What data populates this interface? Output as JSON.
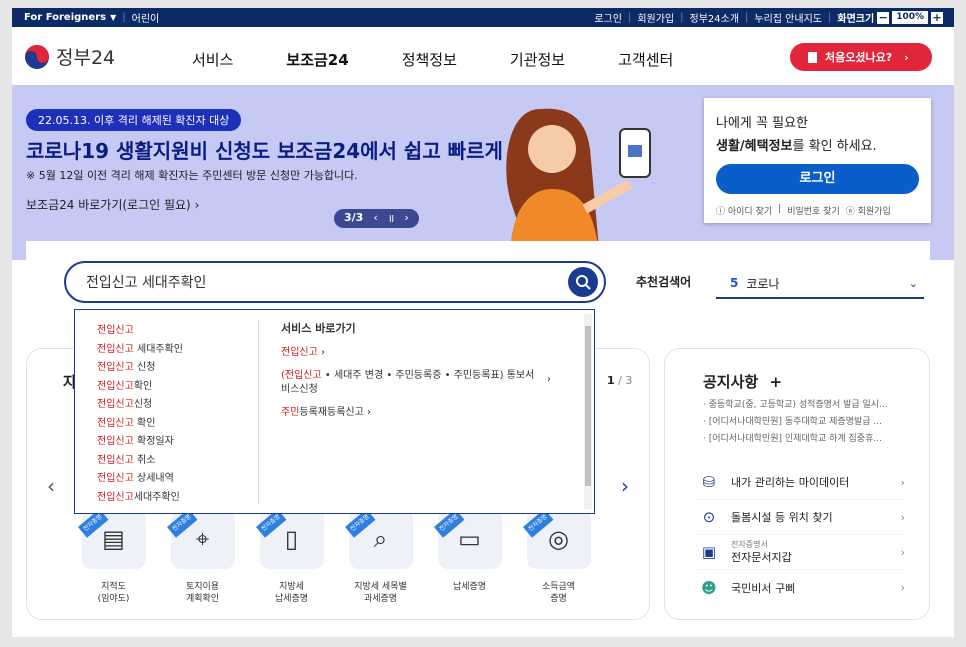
{
  "topbar": {
    "foreigners": "For Foreigners",
    "children": "어린이",
    "login": "로그인",
    "signup": "회원가입",
    "intro": "정부24소개",
    "sitemap": "누리집 안내지도",
    "screen_size": "화면크기",
    "zoom": "100%"
  },
  "header": {
    "logo": "정부24",
    "menu": [
      "서비스",
      "보조금24",
      "정책정보",
      "기관정보",
      "고객센터"
    ],
    "first_visit": "처음오셨나요?"
  },
  "banner": {
    "tag": "22.05.13. 이후 격리 해제된 확진자 대상",
    "headline": "코로나19 생활지원비 신청도 보조금24에서 쉽고 빠르게",
    "sub": "※ 5월 12일 이전 격리 해제 확진자는 주민센터 방문 신청만 가능합니다.",
    "link": "보조금24 바로가기(로그인 필요)",
    "pager": "3/3"
  },
  "login_box": {
    "line1": "나에게 꼭 필요한",
    "line2_bold": "생활/혜택정보",
    "line2_rest": "를 확인 하세요.",
    "button": "로그인",
    "find_id": "아이디 찾기",
    "find_pw": "비밀번호 찾기",
    "join": "회원가입"
  },
  "search": {
    "value": "전입신고 세대주확인",
    "recommend_label": "추천검색어",
    "recommend_num": "5",
    "recommend_word": "코로나"
  },
  "autocomplete": {
    "items": [
      {
        "hl": "전입신고",
        "rest": ""
      },
      {
        "hl": "전입신고",
        "rest": " 세대주확인"
      },
      {
        "hl": "전입신고",
        "rest": " 신청"
      },
      {
        "hl": "전입신고",
        "rest": "확인"
      },
      {
        "hl": "전입신고",
        "rest": "신청"
      },
      {
        "hl": "전입신고",
        "rest": " 확인"
      },
      {
        "hl": "전입신고",
        "rest": " 확정일자"
      },
      {
        "hl": "전입신고",
        "rest": " 취소"
      },
      {
        "hl": "전입신고",
        "rest": " 상세내역"
      },
      {
        "hl": "전입신고",
        "rest": "세대주확인"
      }
    ],
    "shortcut_title": "서비스 바로가기",
    "shortcut1": "전입신고",
    "shortcut2_hl": "(전입신고",
    "shortcut2_rest": " • 세대주 변경 • 주민등록증 • 주민등록표) 통보서 비스신청",
    "shortcut3_hl": "주민",
    "shortcut3_rest": "등록재등록신고"
  },
  "services": {
    "title": "자",
    "page_current": "1",
    "page_total": " / 3",
    "badge": "전자증명",
    "items": [
      {
        "name": "지적도\n(임야도)",
        "icon": "map-icon"
      },
      {
        "name": "토지이용\n계획확인",
        "icon": "location-icon"
      },
      {
        "name": "지방세\n납세증명",
        "icon": "document-icon"
      },
      {
        "name": "지방세 세목별\n과세증명",
        "icon": "chart-search-icon"
      },
      {
        "name": "납세증명",
        "icon": "coins-doc-icon"
      },
      {
        "name": "소득금액\n증명",
        "icon": "coins-icon"
      }
    ]
  },
  "notice": {
    "title": "공지사항",
    "plus": "+",
    "items": [
      "· 중등학교(중, 고등학교) 성적증명서 발급 일시...",
      "· [어디서나대학민원] 동주대학교 제증명발급 ...",
      "· [어디서나대학민원] 인제대학교 하계 집중휴..."
    ]
  },
  "quick": [
    {
      "label": "내가 관리하는 마이데이터",
      "small": "",
      "icon": "database-icon"
    },
    {
      "label": "돌봄시설 등 위치 찾기",
      "small": "",
      "icon": "pin-icon"
    },
    {
      "label": "전자문서지갑",
      "small": "전자증명서",
      "icon": "wallet-icon"
    },
    {
      "label": "국민비서 구삐",
      "small": "",
      "icon": "bot-icon"
    }
  ]
}
